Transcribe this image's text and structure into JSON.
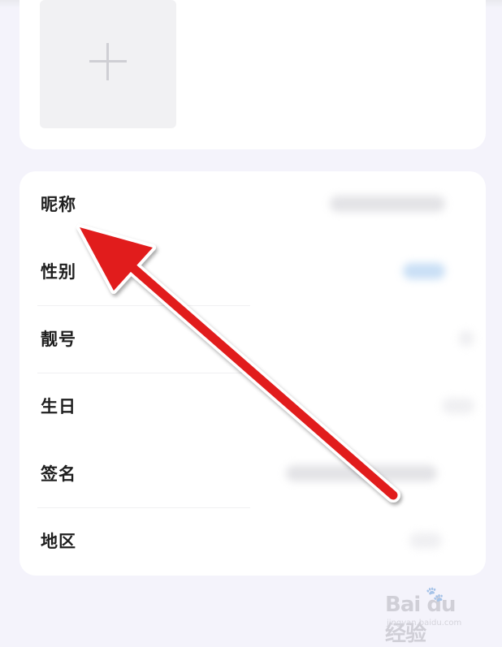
{
  "profile": {
    "fields": [
      {
        "id": "nickname",
        "label": "昵称"
      },
      {
        "id": "gender",
        "label": "性别"
      },
      {
        "id": "pretty_number",
        "label": "靓号"
      },
      {
        "id": "birthday",
        "label": "生日"
      },
      {
        "id": "signature",
        "label": "签名"
      },
      {
        "id": "region",
        "label": "地区"
      }
    ]
  },
  "photo_tile": {
    "icon": "plus-icon"
  },
  "annotation": {
    "type": "red-arrow",
    "color": "#e11a1f",
    "points_to": "nickname"
  },
  "watermark": {
    "logo_text": "Bai du 经验",
    "url": "jingyan.baidu.com"
  }
}
